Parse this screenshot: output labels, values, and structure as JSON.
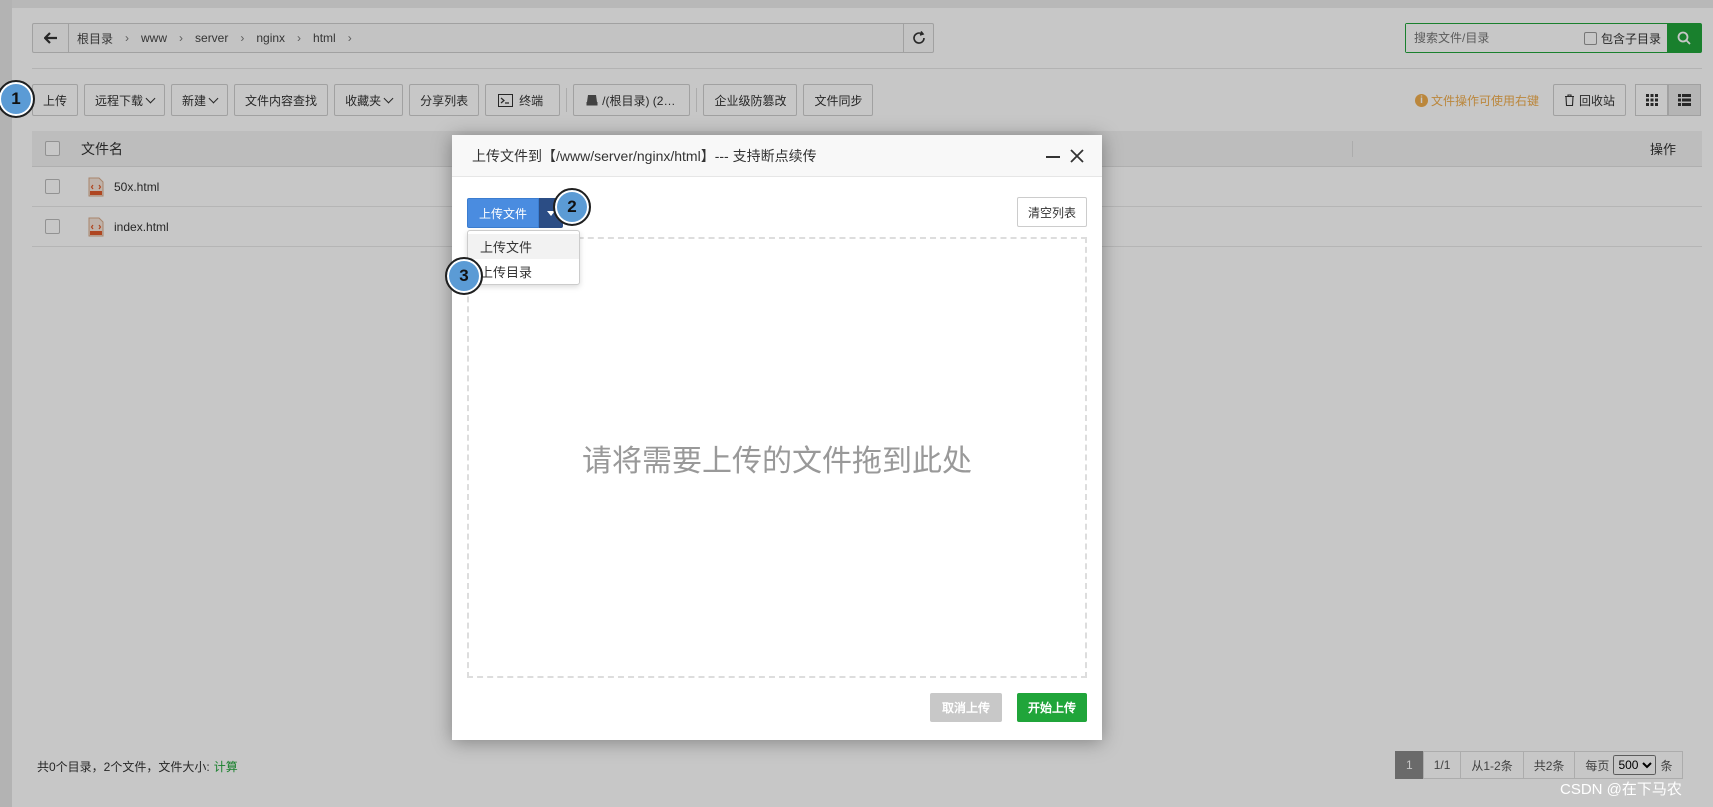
{
  "pathbar": {
    "crumbs": [
      "根目录",
      "www",
      "server",
      "nginx",
      "html"
    ]
  },
  "search": {
    "placeholder": "搜索文件/目录",
    "subdir_label": "包含子目录"
  },
  "toolbar": {
    "upload": "上传",
    "remote_download": "远程下载",
    "new": "新建",
    "content_search": "文件内容查找",
    "favorites": "收藏夹",
    "share_list": "分享列表",
    "terminal": "终端",
    "disk": "/(根目录) (2…",
    "tamper_proof": "企业级防篡改",
    "file_sync": "文件同步",
    "tip": "文件操作可使用右键",
    "recycle": "回收站"
  },
  "table": {
    "col_name": "文件名",
    "col_op": "操作",
    "rows": [
      {
        "name": "50x.html"
      },
      {
        "name": "index.html"
      }
    ]
  },
  "footer": {
    "summary": "共0个目录，2个文件，文件大小:",
    "calc": "计算",
    "page_current": "1",
    "page_total": "1/1",
    "range": "从1-2条",
    "count": "共2条",
    "per_page_label": "每页",
    "per_page_value": "500",
    "per_page_unit": "条"
  },
  "watermark": "CSDN @在下马农",
  "modal": {
    "title": "上传文件到【/www/server/nginx/html】--- 支持断点续传",
    "upload_btn": "上传文件",
    "clear_btn": "清空列表",
    "dropzone_text": "请将需要上传的文件拖到此处",
    "dropdown": [
      "上传文件",
      "上传目录"
    ],
    "cancel_btn": "取消上传",
    "start_btn": "开始上传"
  },
  "markers": [
    "1",
    "2",
    "3"
  ],
  "colors": {
    "primary_green": "#20a53a",
    "upload_blue": "#4a8ce0",
    "tip_orange": "#f0ad4e",
    "marker_blue": "#5b9bd5"
  }
}
